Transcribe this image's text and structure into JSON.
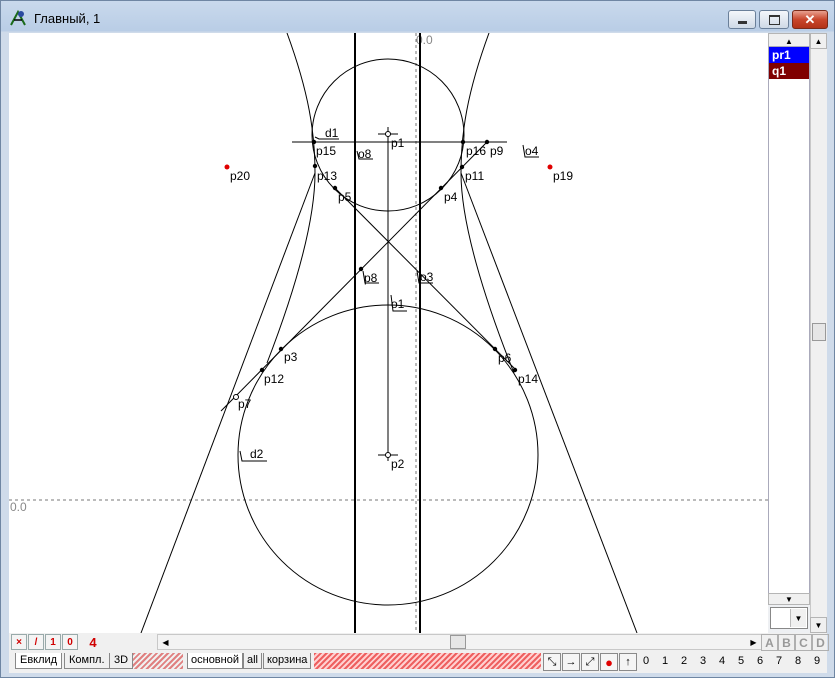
{
  "window": {
    "title": "Главный, 1"
  },
  "axes": {
    "origin_label_top": "0.0",
    "origin_label_left": "0.0"
  },
  "objects_list": [
    {
      "label": "pr1",
      "color": "#0000ff"
    },
    {
      "label": "q1",
      "color": "#800000"
    }
  ],
  "canvas_labels": {
    "p1": "p1",
    "p2": "p2",
    "p3": "p3",
    "p4": "p4",
    "p5": "p5",
    "p6": "p6",
    "p7": "p7",
    "p8": "p8",
    "p9": "p9",
    "p11": "p11",
    "p12": "p12",
    "p13": "p13",
    "p14": "p14",
    "p15": "p15",
    "p16": "p16",
    "p19": "p19",
    "p20": "p20",
    "o1": "o1",
    "o3": "o3",
    "o4": "o4",
    "o8": "o8",
    "d1": "d1",
    "d2": "d2"
  },
  "bottom_toolbar": {
    "btn_x": "×",
    "btn_slash": "/",
    "btn_one": "1",
    "btn_zero": "0",
    "btn_four": "4"
  },
  "tabs": {
    "left": [
      "Евклид",
      "Компл.",
      "3D"
    ],
    "right": [
      "основной",
      "all",
      "корзина"
    ]
  },
  "digits": [
    "0",
    "1",
    "2",
    "3",
    "4",
    "5",
    "6",
    "7",
    "8",
    "9"
  ],
  "abcd": [
    "A",
    "B",
    "C",
    "D"
  ]
}
